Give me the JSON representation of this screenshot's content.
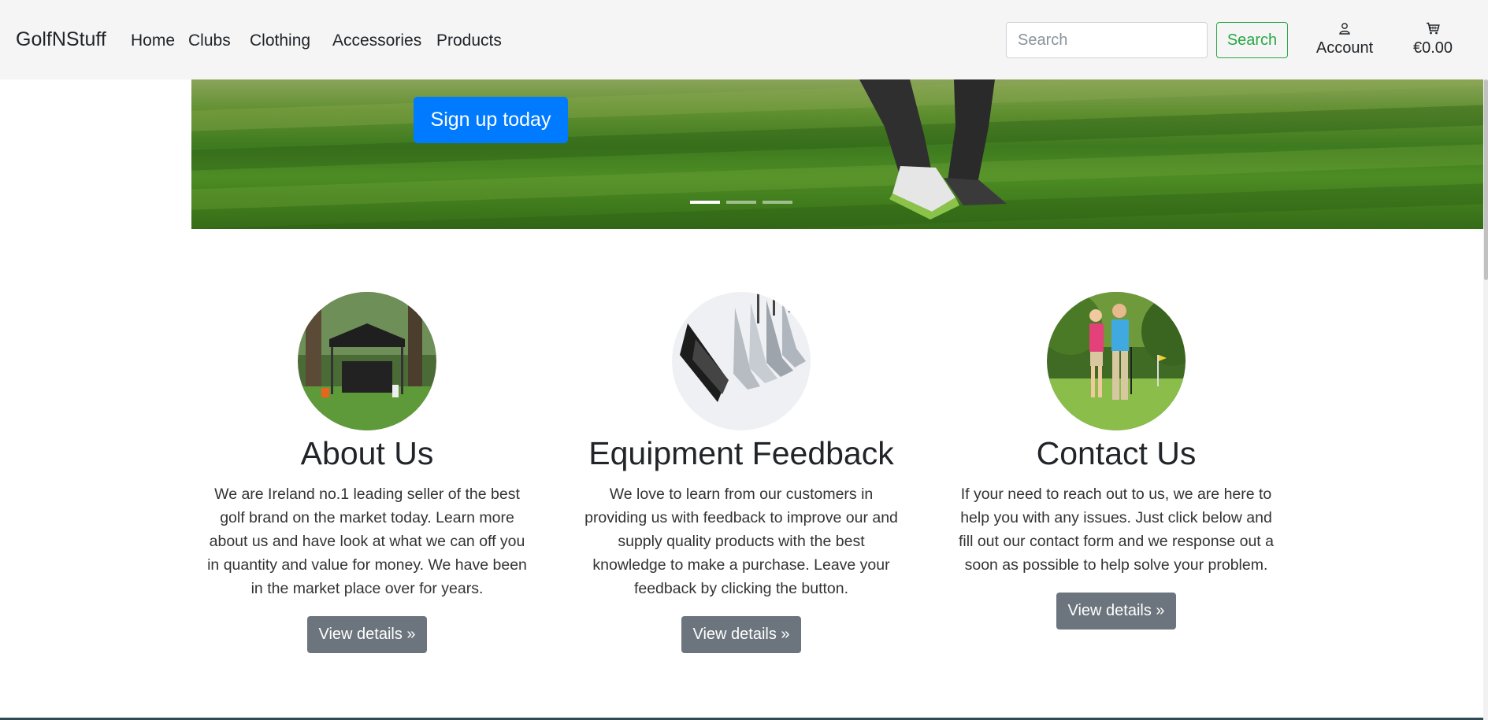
{
  "navbar": {
    "brand": "GolfNStuff",
    "links": [
      "Home",
      "Clubs",
      "Clothing",
      "Accessories",
      "Products"
    ],
    "search_placeholder": "Search",
    "search_button": "Search",
    "account_label": "Account",
    "account_icon": "user-icon",
    "cart_total": "€0.00",
    "cart_icon": "cart-icon"
  },
  "hero": {
    "cta_label": "Sign up today",
    "active_slide": 1,
    "slide_count": 3
  },
  "features": [
    {
      "title": "About Us",
      "text": "We are Ireland no.1 leading seller of the best golf brand on the market today. Learn more about us and have look at what we can off you in quantity and value for money. We have been in the market place over for years.",
      "button": "View details »",
      "image": "golf-tent-photo"
    },
    {
      "title": "Equipment Feedback",
      "text": "We love to learn from our customers in providing us with feedback to improve our and supply quality products with the best knowledge to make a purchase. Leave your feedback by clicking the button.",
      "button": "View details »",
      "image": "golf-clubs-photo"
    },
    {
      "title": "Contact Us",
      "text": "If your need to reach out to us, we are here to help you with any issues. Just click below and fill out our contact form and we response out a soon as possible to help solve your problem.",
      "button": "View details »",
      "image": "golf-couple-photo"
    }
  ],
  "colors": {
    "navbar_bg": "#f5f5f5",
    "primary": "#007bff",
    "success": "#28a745",
    "secondary": "#6c757d"
  }
}
